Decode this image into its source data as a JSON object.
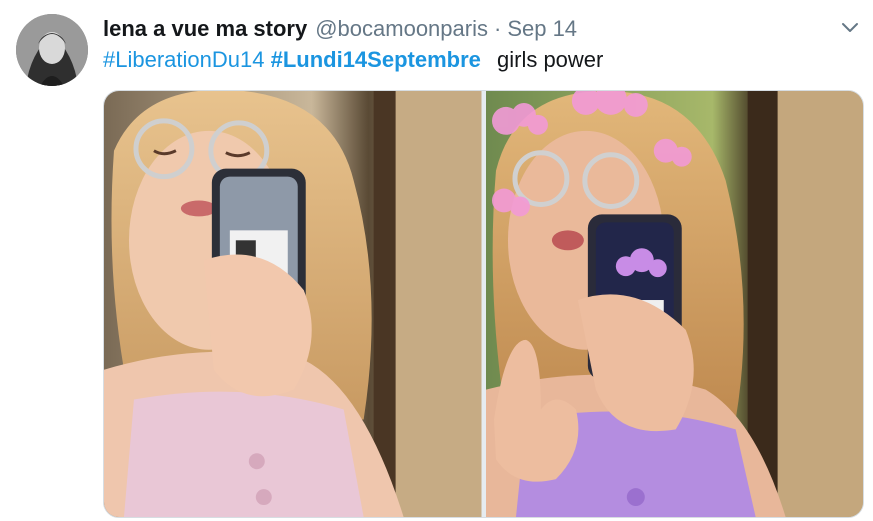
{
  "tweet": {
    "display_name": "lena a vue ma story",
    "handle": "@bocamoonparis",
    "separator": "·",
    "timestamp": "Sep 14",
    "hashtags": [
      "#LiberationDu14",
      "#Lundi14Septembre"
    ],
    "plain_text": "girls power",
    "menu_icon": "chevron-down-icon",
    "media": [
      {
        "name": "photo-1",
        "subject": "mirror-selfie"
      },
      {
        "name": "photo-2",
        "subject": "mirror-selfie-with-sticker-effects"
      }
    ]
  },
  "colors": {
    "link": "#1b95e0",
    "text": "#14171a",
    "muted": "#657786"
  }
}
